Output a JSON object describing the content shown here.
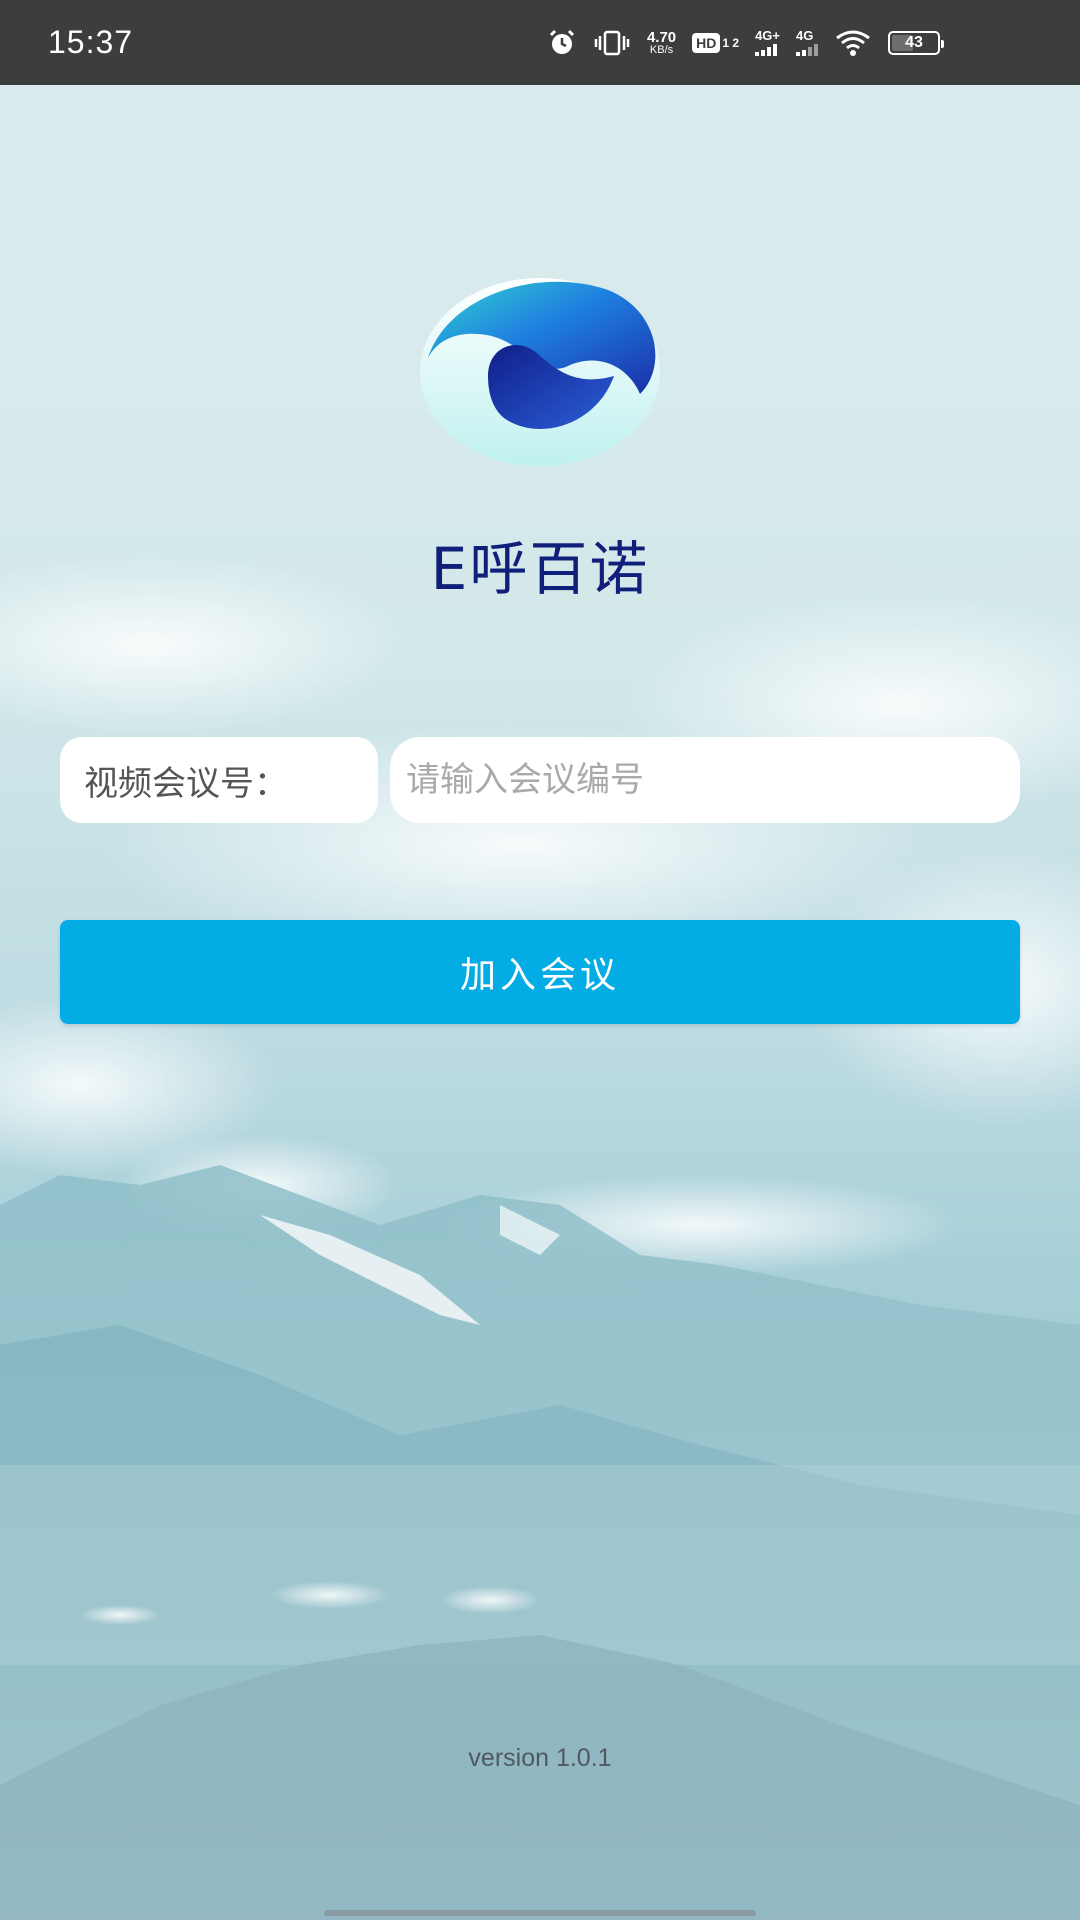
{
  "status_bar": {
    "time": "15:37",
    "net_speed_value": "4.70",
    "net_speed_unit": "KB/s",
    "hd_label": "HD",
    "hd_sub": "1 2",
    "signal1_label": "4G+",
    "signal2_label": "4G",
    "battery_level": "43",
    "icons": [
      "alarm-icon",
      "vibrate-icon",
      "hd-voice-icon",
      "signal-icon",
      "wifi-icon",
      "battery-icon"
    ]
  },
  "app": {
    "name": "E呼百诺",
    "logo_icon": "app-logo",
    "brand_colors": [
      "#1a3fb0",
      "#2fc8d8",
      "#0f1f7a"
    ]
  },
  "form": {
    "meeting_label": "视频会议号：",
    "meeting_input_value": "",
    "meeting_input_placeholder": "请输入会议编号",
    "join_button_label": "加入会议",
    "join_button_color": "#03ace4"
  },
  "footer": {
    "version": "version 1.0.1"
  }
}
